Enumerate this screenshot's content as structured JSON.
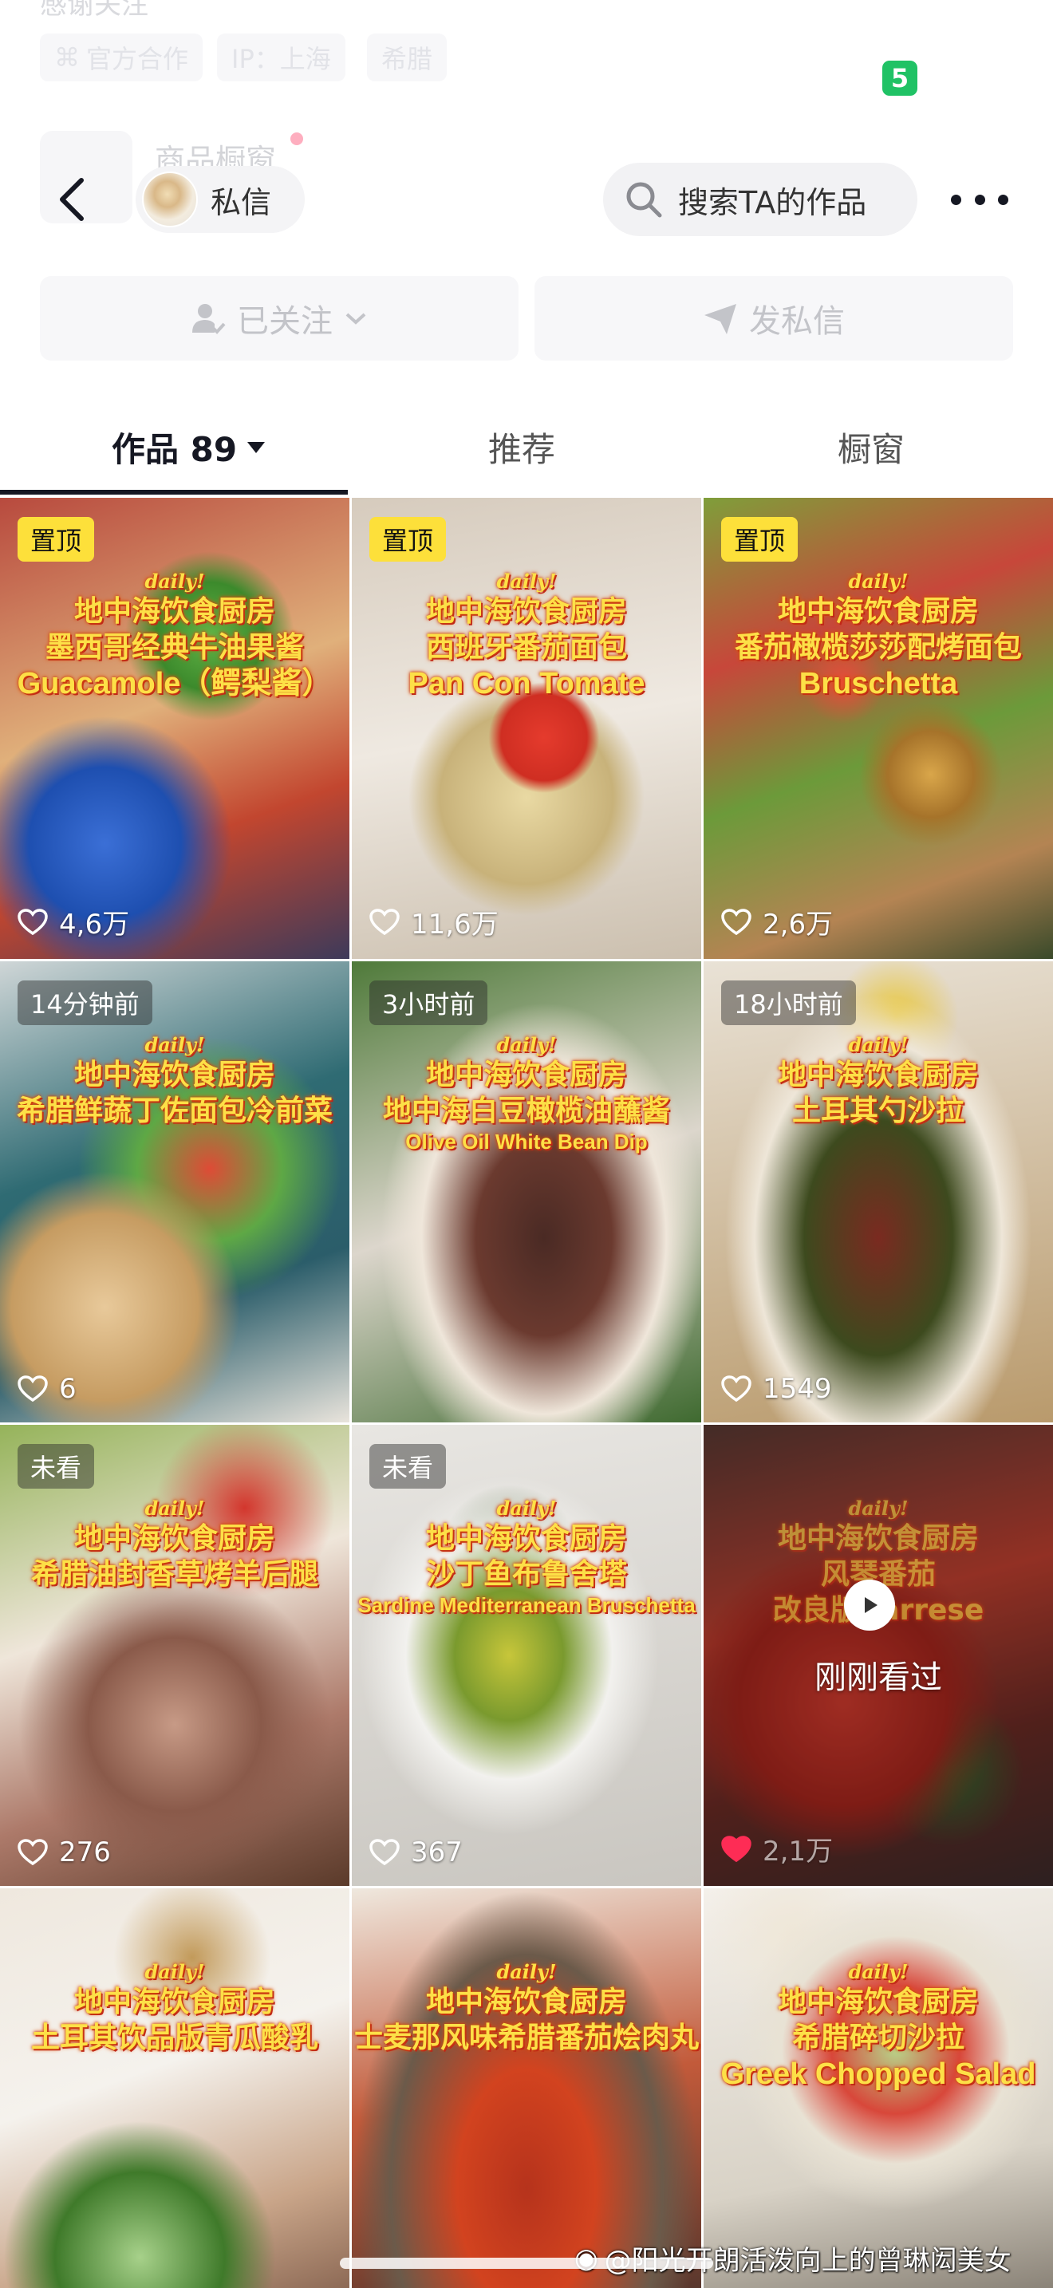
{
  "bg_header": {
    "bio_fragment": "感谢关注",
    "chips": [
      "官方合作",
      "IP：上海",
      "希腊"
    ],
    "green_badge": "5",
    "shop_window_label": "商品橱窗"
  },
  "topbar": {
    "message_label": "私信",
    "search_placeholder": "搜索TA的作品"
  },
  "actions": {
    "followed_label": "已关注",
    "send_message_label": "发私信"
  },
  "tabs": [
    {
      "label": "作品 89",
      "active": true
    },
    {
      "label": "推荐",
      "active": false
    },
    {
      "label": "橱窗",
      "active": false
    }
  ],
  "grid": [
    {
      "badge": "置顶",
      "badge_type": "pin",
      "daily": "daily!",
      "lines": [
        "地中海饮食厨房",
        "墨西哥经典牛油果酱"
      ],
      "en": "Guacamole（鳄梨酱）",
      "likes": "4,6万"
    },
    {
      "badge": "置顶",
      "badge_type": "pin",
      "daily": "daily!",
      "lines": [
        "地中海饮食厨房",
        "西班牙番茄面包"
      ],
      "en": "Pan Con Tomate",
      "likes": "11,6万"
    },
    {
      "badge": "置顶",
      "badge_type": "pin",
      "daily": "daily!",
      "lines": [
        "地中海饮食厨房",
        "番茄橄榄莎莎配烤面包"
      ],
      "en": "Bruschetta",
      "likes": "2,6万"
    },
    {
      "badge": "14分钟前",
      "badge_type": "time",
      "daily": "daily!",
      "lines": [
        "地中海饮食厨房",
        "希腊鲜蔬丁佐面包冷前菜"
      ],
      "en": "",
      "likes": "6"
    },
    {
      "badge": "3小时前",
      "badge_type": "time",
      "daily": "daily!",
      "lines": [
        "地中海饮食厨房",
        "地中海白豆橄榄油蘸酱"
      ],
      "en": "Olive Oil White Bean Dip",
      "likes": ""
    },
    {
      "badge": "18小时前",
      "badge_type": "time",
      "daily": "daily!",
      "lines": [
        "地中海饮食厨房",
        "土耳其勺沙拉"
      ],
      "en": "",
      "likes": "1549"
    },
    {
      "badge": "未看",
      "badge_type": "time",
      "daily": "daily!",
      "lines": [
        "地中海饮食厨房",
        "希腊油封香草烤羊后腿"
      ],
      "en": "",
      "likes": "276"
    },
    {
      "badge": "未看",
      "badge_type": "time",
      "daily": "daily!",
      "lines": [
        "地中海饮食厨房",
        "沙丁鱼布鲁舍塔"
      ],
      "en": "Sardine Mediterranean Bruschetta",
      "likes": "367"
    },
    {
      "badge": "",
      "badge_type": "none",
      "daily": "daily!",
      "lines": [
        "地中海饮食厨房",
        "风琴番茄",
        "改良版Carrese"
      ],
      "en": "",
      "likes": "2,1万",
      "watched": "刚刚看过"
    },
    {
      "badge": "",
      "badge_type": "none",
      "daily": "daily!",
      "lines": [
        "地中海饮食厨房",
        "土耳其饮品版青瓜酸乳"
      ],
      "en": "",
      "likes": ""
    },
    {
      "badge": "",
      "badge_type": "none",
      "daily": "daily!",
      "lines": [
        "地中海饮食厨房",
        "士麦那风味希腊番茄烩肉丸"
      ],
      "en": "",
      "likes": ""
    },
    {
      "badge": "",
      "badge_type": "none",
      "daily": "daily!",
      "lines": [
        "地中海饮食厨房",
        "希腊碎切沙拉"
      ],
      "en": "Greek Chopped Salad",
      "likes": ""
    }
  ],
  "watermark": "@阳光开朗活泼向上的曾琳闳美女",
  "colors": {
    "pin_badge": "#fde03a",
    "title_text": "#fde047",
    "green_badge": "#20c265",
    "accent_text": "#161823"
  }
}
